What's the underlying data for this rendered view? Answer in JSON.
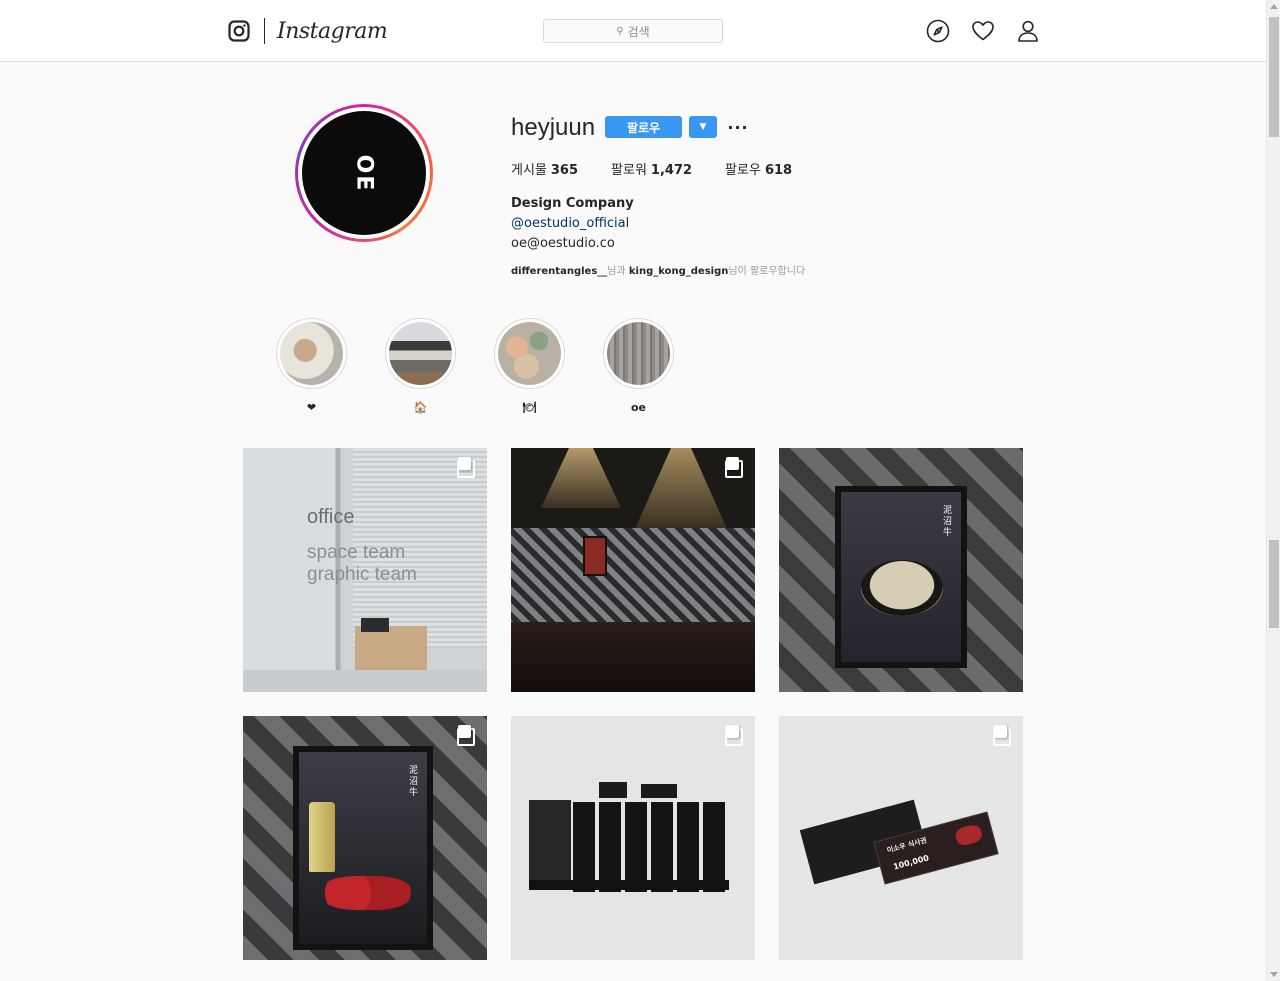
{
  "nav": {
    "wordmark": "Instagram",
    "search_placeholder": "검색",
    "icons": [
      "camera-icon",
      "compass-icon",
      "heart-icon",
      "person-icon"
    ]
  },
  "profile": {
    "avatar_text": "OE",
    "username": "heyjuun",
    "follow_label": "팔로우",
    "dropdown_label": "▼",
    "more_label": "···",
    "stats": [
      {
        "label": "게시물",
        "value": "365"
      },
      {
        "label": "팔로워",
        "value": "1,472"
      },
      {
        "label": "팔로우",
        "value": "618"
      }
    ],
    "bio_name": "Design Company",
    "bio_handle": "@oestudio_official",
    "bio_email": "oe@oestudio.co",
    "followed_by": {
      "user1": "differentangles__",
      "mid": "님과 ",
      "user2": "king_kong_design",
      "tail": "님이 팔로우합니다"
    }
  },
  "highlights": [
    {
      "label": "❤"
    },
    {
      "label": "🏠"
    },
    {
      "label": "🍽"
    },
    {
      "label": "oe"
    }
  ],
  "posts": [
    {
      "office_title": "office",
      "office_line2": "space team",
      "office_line3": "graphic team"
    },
    {},
    {
      "kanji": "泥沼牛"
    },
    {
      "kanji": "泥沼牛"
    },
    {},
    {
      "ticket_title": "이소우 식사권",
      "ticket_value": "100,000"
    }
  ],
  "colors": {
    "accent": "#3897f0",
    "link": "#003569",
    "border": "#dbdbdb",
    "background": "#fafafa"
  }
}
